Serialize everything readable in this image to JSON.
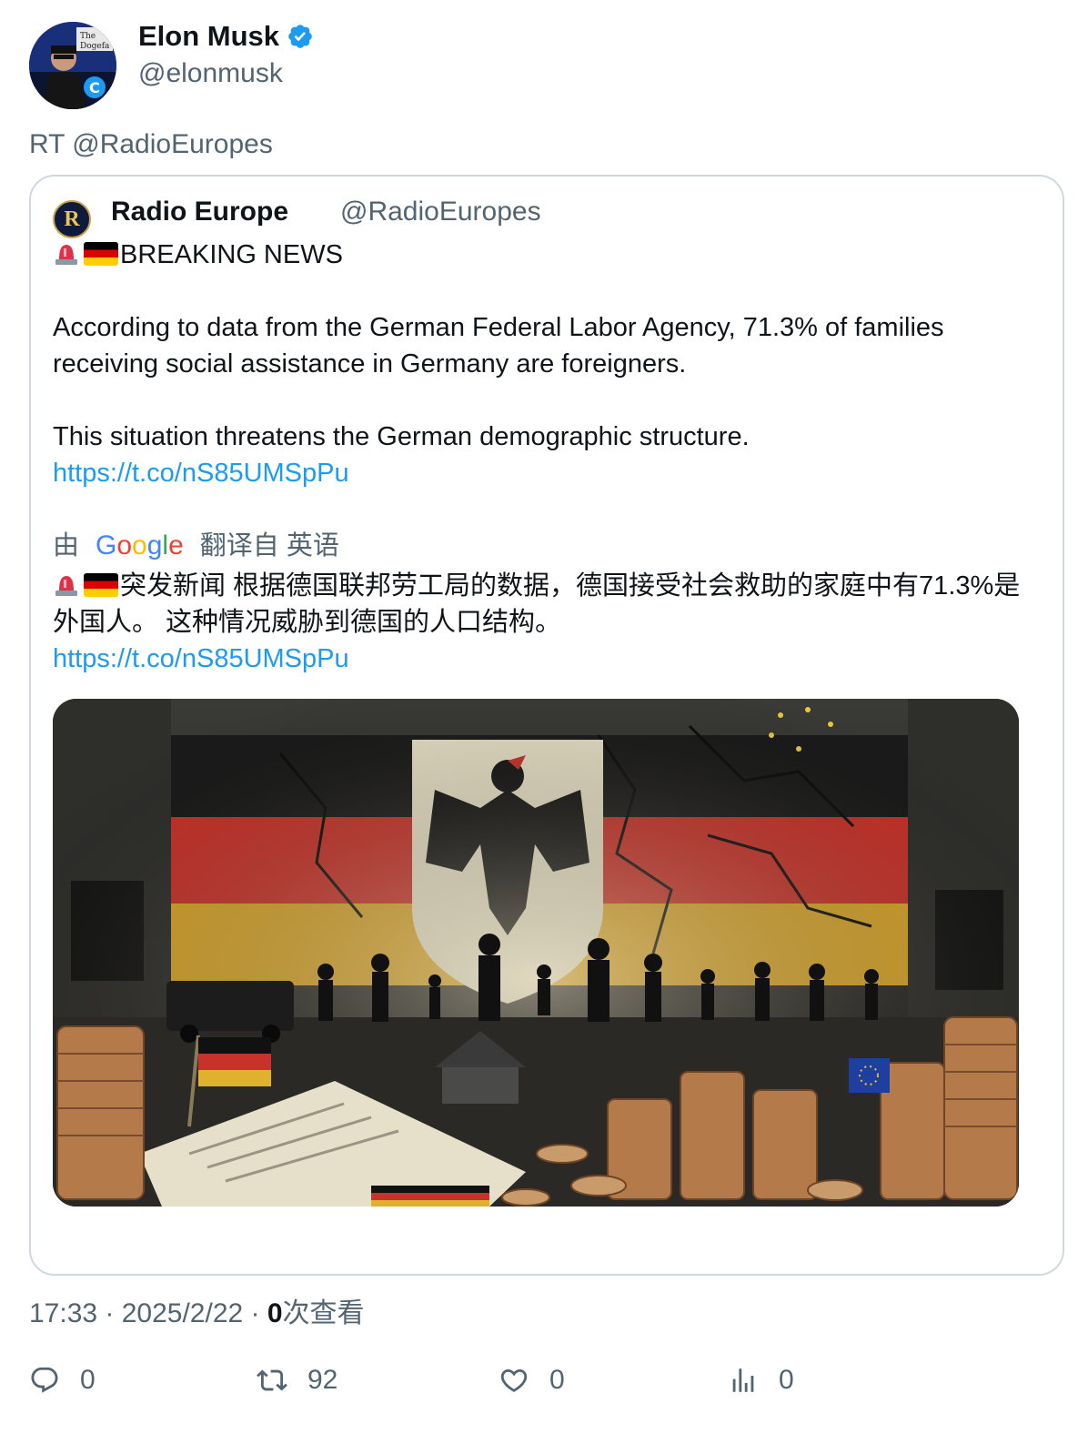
{
  "author": {
    "name": "Elon Musk",
    "handle": "@elonmusk",
    "verified": true,
    "verified_color": "#1d9bf0"
  },
  "retweet_line": "RT @RadioEuropes",
  "quoted": {
    "name": "Radio Europe",
    "handle": "@RadioEuropes",
    "avatar_letter": "R",
    "headline": "BREAKING NEWS",
    "paragraph1": "According to data from the German Federal Labor Agency, 71.3% of families receiving social assistance in Germany are foreigners.",
    "paragraph2": "This situation threatens the German demographic structure.",
    "link1": "https://t.co/nS85UMSpPu",
    "translate_prefix": "由",
    "translate_suffix": "翻译自 英语",
    "translation_text": "突发新闻 根据德国联邦劳工局的数据，德国接受社会救助的家庭中有71.3%是外国人。 这种情况威胁到德国的人口结构。",
    "link2": "https://t.co/nS85UMSpPu",
    "image_description_icon": "german-flag-eagle-illustration"
  },
  "meta": {
    "time": "17:33 · 2025/2/22 · ",
    "views_count": "0",
    "views_label": "次查看"
  },
  "actions": {
    "replies": "0",
    "retweets": "92",
    "likes": "0",
    "views": "0"
  },
  "colors": {
    "link": "#1d9bf0",
    "secondary_text": "#536471",
    "border": "#cfd9de"
  }
}
